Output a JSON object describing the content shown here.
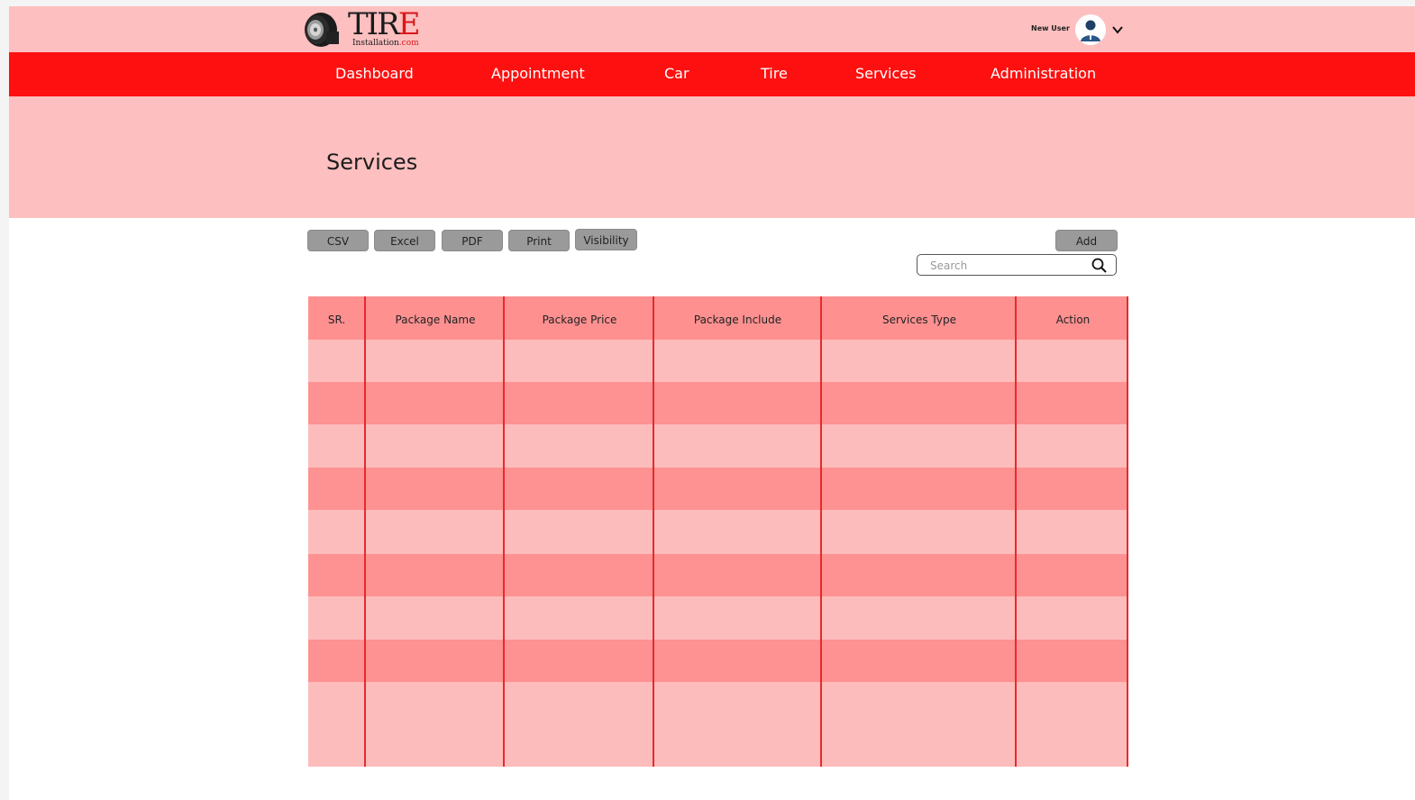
{
  "brand": {
    "logo_word_main": "TIR",
    "logo_word_accent": "E",
    "logo_sub_main": "Installation",
    "logo_sub_accent": ".com",
    "primary_color": "#fe1010",
    "accent_pink": "#fdbfbf",
    "row_dark": "#fe9191"
  },
  "user": {
    "name": "New User",
    "avatar_icon": "user-avatar-icon",
    "menu_icon": "chevron-down-icon"
  },
  "nav": {
    "items": [
      {
        "label": "Dashboard"
      },
      {
        "label": "Appointment"
      },
      {
        "label": "Car"
      },
      {
        "label": "Tire"
      },
      {
        "label": "Services"
      },
      {
        "label": "Administration"
      }
    ]
  },
  "page": {
    "title": "Services"
  },
  "toolbar": {
    "export_buttons": [
      {
        "label": "CSV"
      },
      {
        "label": "Excel"
      },
      {
        "label": "PDF"
      },
      {
        "label": "Print"
      },
      {
        "label": "Visibility"
      }
    ],
    "add_label": "Add",
    "search_placeholder": "Search",
    "search_icon": "search-icon"
  },
  "table": {
    "columns": [
      "SR.",
      "Package Name",
      "Package Price",
      "Package Include",
      "Services Type",
      "Action"
    ],
    "rows": []
  }
}
